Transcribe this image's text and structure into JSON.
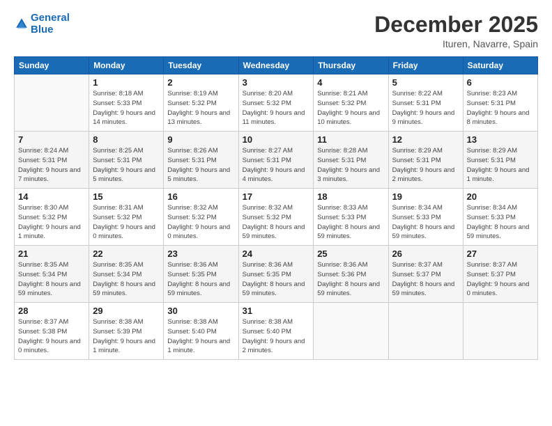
{
  "header": {
    "logo_line1": "General",
    "logo_line2": "Blue",
    "month": "December 2025",
    "location": "Ituren, Navarre, Spain"
  },
  "weekdays": [
    "Sunday",
    "Monday",
    "Tuesday",
    "Wednesday",
    "Thursday",
    "Friday",
    "Saturday"
  ],
  "weeks": [
    [
      {
        "day": "",
        "sunrise": "",
        "sunset": "",
        "daylight": ""
      },
      {
        "day": "1",
        "sunrise": "Sunrise: 8:18 AM",
        "sunset": "Sunset: 5:33 PM",
        "daylight": "Daylight: 9 hours and 14 minutes."
      },
      {
        "day": "2",
        "sunrise": "Sunrise: 8:19 AM",
        "sunset": "Sunset: 5:32 PM",
        "daylight": "Daylight: 9 hours and 13 minutes."
      },
      {
        "day": "3",
        "sunrise": "Sunrise: 8:20 AM",
        "sunset": "Sunset: 5:32 PM",
        "daylight": "Daylight: 9 hours and 11 minutes."
      },
      {
        "day": "4",
        "sunrise": "Sunrise: 8:21 AM",
        "sunset": "Sunset: 5:32 PM",
        "daylight": "Daylight: 9 hours and 10 minutes."
      },
      {
        "day": "5",
        "sunrise": "Sunrise: 8:22 AM",
        "sunset": "Sunset: 5:31 PM",
        "daylight": "Daylight: 9 hours and 9 minutes."
      },
      {
        "day": "6",
        "sunrise": "Sunrise: 8:23 AM",
        "sunset": "Sunset: 5:31 PM",
        "daylight": "Daylight: 9 hours and 8 minutes."
      }
    ],
    [
      {
        "day": "7",
        "sunrise": "Sunrise: 8:24 AM",
        "sunset": "Sunset: 5:31 PM",
        "daylight": "Daylight: 9 hours and 7 minutes."
      },
      {
        "day": "8",
        "sunrise": "Sunrise: 8:25 AM",
        "sunset": "Sunset: 5:31 PM",
        "daylight": "Daylight: 9 hours and 5 minutes."
      },
      {
        "day": "9",
        "sunrise": "Sunrise: 8:26 AM",
        "sunset": "Sunset: 5:31 PM",
        "daylight": "Daylight: 9 hours and 5 minutes."
      },
      {
        "day": "10",
        "sunrise": "Sunrise: 8:27 AM",
        "sunset": "Sunset: 5:31 PM",
        "daylight": "Daylight: 9 hours and 4 minutes."
      },
      {
        "day": "11",
        "sunrise": "Sunrise: 8:28 AM",
        "sunset": "Sunset: 5:31 PM",
        "daylight": "Daylight: 9 hours and 3 minutes."
      },
      {
        "day": "12",
        "sunrise": "Sunrise: 8:29 AM",
        "sunset": "Sunset: 5:31 PM",
        "daylight": "Daylight: 9 hours and 2 minutes."
      },
      {
        "day": "13",
        "sunrise": "Sunrise: 8:29 AM",
        "sunset": "Sunset: 5:31 PM",
        "daylight": "Daylight: 9 hours and 1 minute."
      }
    ],
    [
      {
        "day": "14",
        "sunrise": "Sunrise: 8:30 AM",
        "sunset": "Sunset: 5:32 PM",
        "daylight": "Daylight: 9 hours and 1 minute."
      },
      {
        "day": "15",
        "sunrise": "Sunrise: 8:31 AM",
        "sunset": "Sunset: 5:32 PM",
        "daylight": "Daylight: 9 hours and 0 minutes."
      },
      {
        "day": "16",
        "sunrise": "Sunrise: 8:32 AM",
        "sunset": "Sunset: 5:32 PM",
        "daylight": "Daylight: 9 hours and 0 minutes."
      },
      {
        "day": "17",
        "sunrise": "Sunrise: 8:32 AM",
        "sunset": "Sunset: 5:32 PM",
        "daylight": "Daylight: 8 hours and 59 minutes."
      },
      {
        "day": "18",
        "sunrise": "Sunrise: 8:33 AM",
        "sunset": "Sunset: 5:33 PM",
        "daylight": "Daylight: 8 hours and 59 minutes."
      },
      {
        "day": "19",
        "sunrise": "Sunrise: 8:34 AM",
        "sunset": "Sunset: 5:33 PM",
        "daylight": "Daylight: 8 hours and 59 minutes."
      },
      {
        "day": "20",
        "sunrise": "Sunrise: 8:34 AM",
        "sunset": "Sunset: 5:33 PM",
        "daylight": "Daylight: 8 hours and 59 minutes."
      }
    ],
    [
      {
        "day": "21",
        "sunrise": "Sunrise: 8:35 AM",
        "sunset": "Sunset: 5:34 PM",
        "daylight": "Daylight: 8 hours and 59 minutes."
      },
      {
        "day": "22",
        "sunrise": "Sunrise: 8:35 AM",
        "sunset": "Sunset: 5:34 PM",
        "daylight": "Daylight: 8 hours and 59 minutes."
      },
      {
        "day": "23",
        "sunrise": "Sunrise: 8:36 AM",
        "sunset": "Sunset: 5:35 PM",
        "daylight": "Daylight: 8 hours and 59 minutes."
      },
      {
        "day": "24",
        "sunrise": "Sunrise: 8:36 AM",
        "sunset": "Sunset: 5:35 PM",
        "daylight": "Daylight: 8 hours and 59 minutes."
      },
      {
        "day": "25",
        "sunrise": "Sunrise: 8:36 AM",
        "sunset": "Sunset: 5:36 PM",
        "daylight": "Daylight: 8 hours and 59 minutes."
      },
      {
        "day": "26",
        "sunrise": "Sunrise: 8:37 AM",
        "sunset": "Sunset: 5:37 PM",
        "daylight": "Daylight: 8 hours and 59 minutes."
      },
      {
        "day": "27",
        "sunrise": "Sunrise: 8:37 AM",
        "sunset": "Sunset: 5:37 PM",
        "daylight": "Daylight: 9 hours and 0 minutes."
      }
    ],
    [
      {
        "day": "28",
        "sunrise": "Sunrise: 8:37 AM",
        "sunset": "Sunset: 5:38 PM",
        "daylight": "Daylight: 9 hours and 0 minutes."
      },
      {
        "day": "29",
        "sunrise": "Sunrise: 8:38 AM",
        "sunset": "Sunset: 5:39 PM",
        "daylight": "Daylight: 9 hours and 1 minute."
      },
      {
        "day": "30",
        "sunrise": "Sunrise: 8:38 AM",
        "sunset": "Sunset: 5:40 PM",
        "daylight": "Daylight: 9 hours and 1 minute."
      },
      {
        "day": "31",
        "sunrise": "Sunrise: 8:38 AM",
        "sunset": "Sunset: 5:40 PM",
        "daylight": "Daylight: 9 hours and 2 minutes."
      },
      {
        "day": "",
        "sunrise": "",
        "sunset": "",
        "daylight": ""
      },
      {
        "day": "",
        "sunrise": "",
        "sunset": "",
        "daylight": ""
      },
      {
        "day": "",
        "sunrise": "",
        "sunset": "",
        "daylight": ""
      }
    ]
  ]
}
